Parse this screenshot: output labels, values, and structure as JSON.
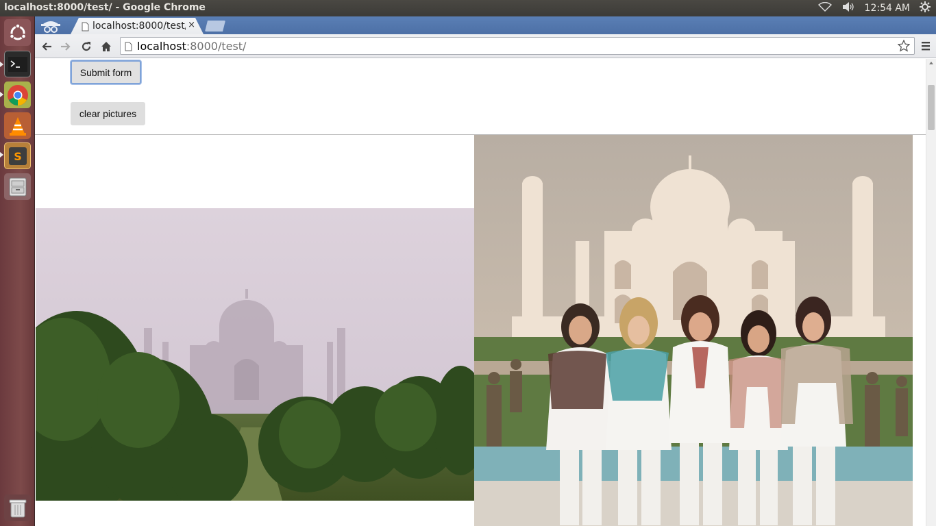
{
  "window": {
    "title": "localhost:8000/test/ - Google Chrome"
  },
  "panel": {
    "clock": "12:54 AM"
  },
  "launcher": {
    "items": [
      {
        "name": "ubuntu-dash",
        "icon": "ubuntu-logo-icon"
      },
      {
        "name": "terminal",
        "icon": "terminal-icon"
      },
      {
        "name": "chrome",
        "icon": "chrome-icon"
      },
      {
        "name": "vlc",
        "icon": "vlc-cone-icon"
      },
      {
        "name": "sublime-text",
        "icon": "sublime-text-icon"
      },
      {
        "name": "file-manager",
        "icon": "file-cabinet-icon"
      },
      {
        "name": "trash",
        "icon": "trash-icon"
      }
    ]
  },
  "browser": {
    "tab": {
      "title": "localhost:8000/test/",
      "close": "×"
    },
    "url": {
      "host": "localhost",
      "rest": ":8000/test/"
    }
  },
  "page": {
    "submit_label": "Submit form",
    "clear_label": "clear pictures",
    "photos": [
      {
        "alt": "Taj Mahal in morning mist behind trees"
      },
      {
        "alt": "Five women posing in front of the Taj Mahal"
      }
    ]
  },
  "colors": {
    "chrome_tab_bar": "#5a7fb5",
    "launcher": "#7d4a4a",
    "panel": "#3c3b37"
  }
}
